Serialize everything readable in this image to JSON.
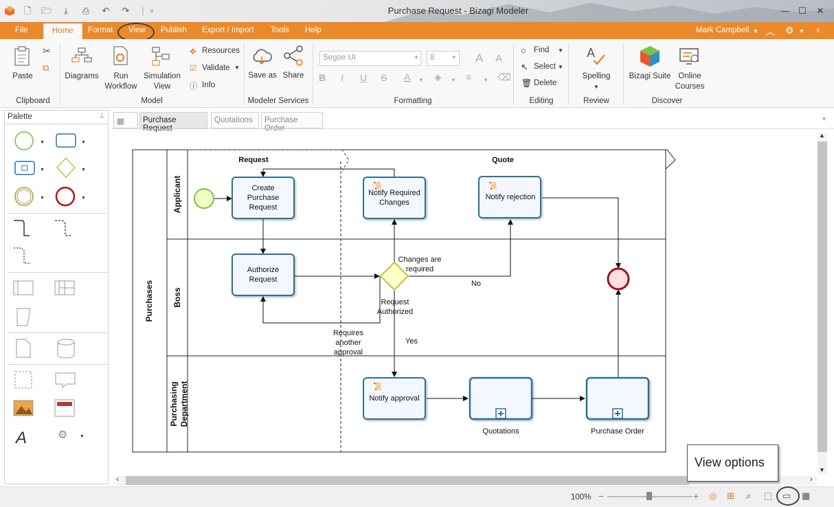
{
  "title_bar": {
    "title": "Purchase Request - Bizagi Modeler"
  },
  "menu": {
    "file": "File",
    "home": "Home",
    "format": "Format",
    "view": "View",
    "publish": "Publish",
    "export_import": "Export / Import",
    "tools": "Tools",
    "help": "Help",
    "user": "Mark Campbell"
  },
  "ribbon": {
    "paste": "Paste",
    "clipboard": "Clipboard",
    "diagrams": "Diagrams",
    "run_workflow": "Run Workflow",
    "simulation_view": "Simulation View",
    "resources": "Resources",
    "validate": "Validate",
    "info": "Info",
    "model": "Model",
    "save_as": "Save as",
    "share": "Share",
    "modeler_services": "Modeler Services",
    "font_name": "Segoe UI",
    "font_size": "8",
    "formatting": "Formatting",
    "find": "Find",
    "select": "Select",
    "delete": "Delete",
    "editing": "Editing",
    "spelling": "Spelling",
    "review": "Review",
    "bizagi_suite": "Bizagi Suite",
    "online_courses": "Online Courses",
    "discover": "Discover"
  },
  "palette": {
    "title": "Palette"
  },
  "tabs": [
    "Purchase Request",
    "Quotations",
    "Purchase Order"
  ],
  "diagram": {
    "pool": "Purchases",
    "lanes": [
      "Applicant",
      "Boss",
      "Purchasing Department"
    ],
    "phases": [
      "Request",
      "Quote"
    ],
    "tasks": {
      "create": "Create Purchase Request",
      "authorize": "Authorize Request",
      "notify_changes": "Notify Required Changes",
      "notify_rejection": "Notify rejection",
      "notify_approval": "Notify approval",
      "quotations": "Quotations",
      "purchase_order": "Purchase Order"
    },
    "labels": {
      "changes_required": "Changes are required",
      "no": "No",
      "request_authorized": "Request Authorized",
      "requires_approval": "Requires another approval",
      "yes": "Yes"
    }
  },
  "status": {
    "zoom": "100%"
  },
  "callout": {
    "text": "View options"
  }
}
